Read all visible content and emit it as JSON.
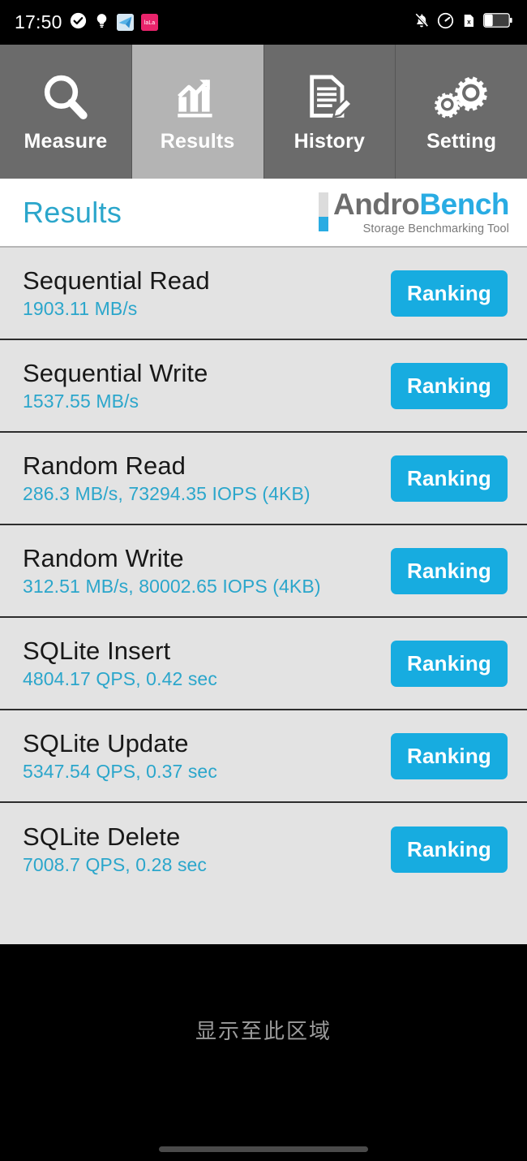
{
  "statusbar": {
    "time": "17:50",
    "left_icons": [
      {
        "name": "check-circle-icon"
      },
      {
        "name": "lightbulb-icon"
      },
      {
        "name": "telegram-app-icon"
      },
      {
        "name": "pink-app-icon"
      }
    ],
    "right_icons": [
      {
        "name": "notifications-muted-icon"
      },
      {
        "name": "data-saver-icon"
      },
      {
        "name": "sim-card-missing-icon"
      },
      {
        "name": "battery-icon"
      }
    ]
  },
  "tabs": [
    {
      "label": "Measure",
      "icon": "magnifier-icon",
      "selected": false
    },
    {
      "label": "Results",
      "icon": "bar-chart-arrow-icon",
      "selected": true
    },
    {
      "label": "History",
      "icon": "document-pencil-icon",
      "selected": false
    },
    {
      "label": "Setting",
      "icon": "gears-icon",
      "selected": false
    }
  ],
  "header": {
    "title": "Results",
    "brand_first": "Andro",
    "brand_second": "Bench",
    "tagline": "Storage Benchmarking Tool"
  },
  "results": [
    {
      "title": "Sequential Read",
      "value": "1903.11 MB/s",
      "button": "Ranking"
    },
    {
      "title": "Sequential Write",
      "value": "1537.55 MB/s",
      "button": "Ranking"
    },
    {
      "title": "Random Read",
      "value": "286.3 MB/s, 73294.35 IOPS (4KB)",
      "button": "Ranking"
    },
    {
      "title": "Random Write",
      "value": "312.51 MB/s, 80002.65 IOPS (4KB)",
      "button": "Ranking"
    },
    {
      "title": "SQLite Insert",
      "value": "4804.17 QPS, 0.42 sec",
      "button": "Ranking"
    },
    {
      "title": "SQLite Update",
      "value": "5347.54 QPS, 0.37 sec",
      "button": "Ranking"
    },
    {
      "title": "SQLite Delete",
      "value": "7008.7 QPS, 0.28 sec",
      "button": "Ranking"
    }
  ],
  "bottom": {
    "hint": "显示至此区域"
  },
  "colors": {
    "accent_blue": "#29ace3",
    "button_blue": "#17ace0",
    "title_blue": "#2ba6cb",
    "tab_unselected": "#6b6b6b",
    "tab_selected": "#b4b4b4",
    "list_background": "#e3e3e3"
  }
}
